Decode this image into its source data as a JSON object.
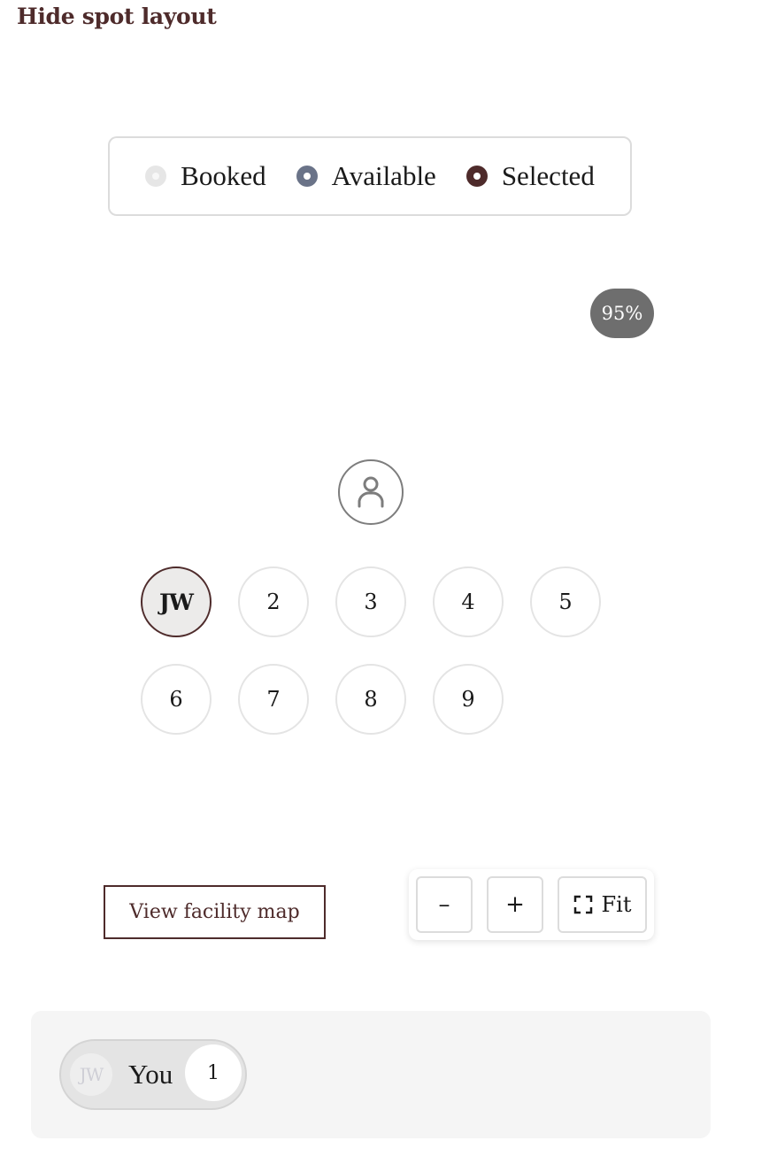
{
  "toggle_layout_label": "Hide spot layout",
  "legend": {
    "booked": "Booked",
    "available": "Available",
    "selected": "Selected"
  },
  "zoom_level": "95%",
  "spots": {
    "s1": "JW",
    "s2": "2",
    "s3": "3",
    "s4": "4",
    "s5": "5",
    "s6": "6",
    "s7": "7",
    "s8": "8",
    "s9": "9"
  },
  "facility_map_label": "View facility map",
  "zoom_controls": {
    "minus": "–",
    "plus": "+",
    "fit": "Fit"
  },
  "attendee": {
    "initials": "JW",
    "label": "You",
    "count": "1"
  },
  "colors": {
    "brand": "#4e2b2b",
    "available": "#6a7388",
    "booked": "#e6e6e6"
  }
}
